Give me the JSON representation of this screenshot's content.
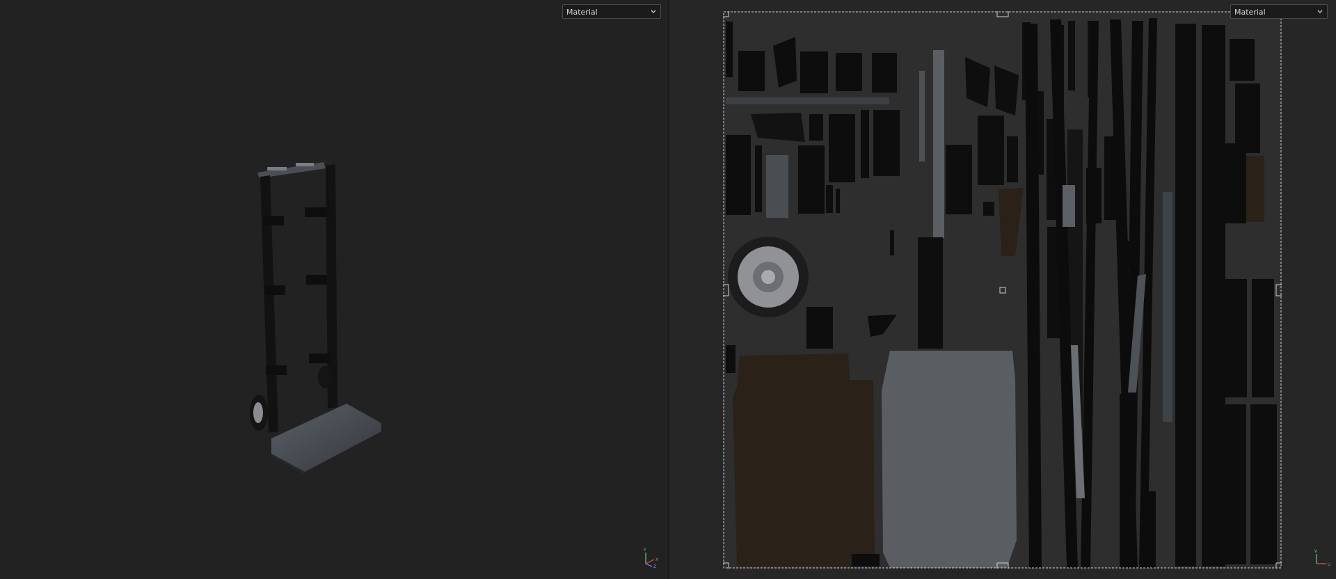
{
  "viewport3d": {
    "material_dropdown": "Material",
    "axis": {
      "y": "Y",
      "x": "X",
      "z": "Z"
    }
  },
  "viewportuv": {
    "material_dropdown": "Material",
    "axis": {
      "v": "V",
      "u": "U"
    }
  },
  "colors": {
    "background": "#222222",
    "uv_island_dark": "#0d0d0d",
    "uv_island_grey": "#5a5e63",
    "uv_island_brown": "#2a2118",
    "selection_box": "#d0d0d0",
    "axis_x": "#c04848",
    "axis_y": "#5fae5f",
    "axis_z": "#6a7fd0"
  },
  "icons": [
    "chevron-down-icon",
    "axis-gizmo-icon",
    "uv-axis-icon"
  ]
}
